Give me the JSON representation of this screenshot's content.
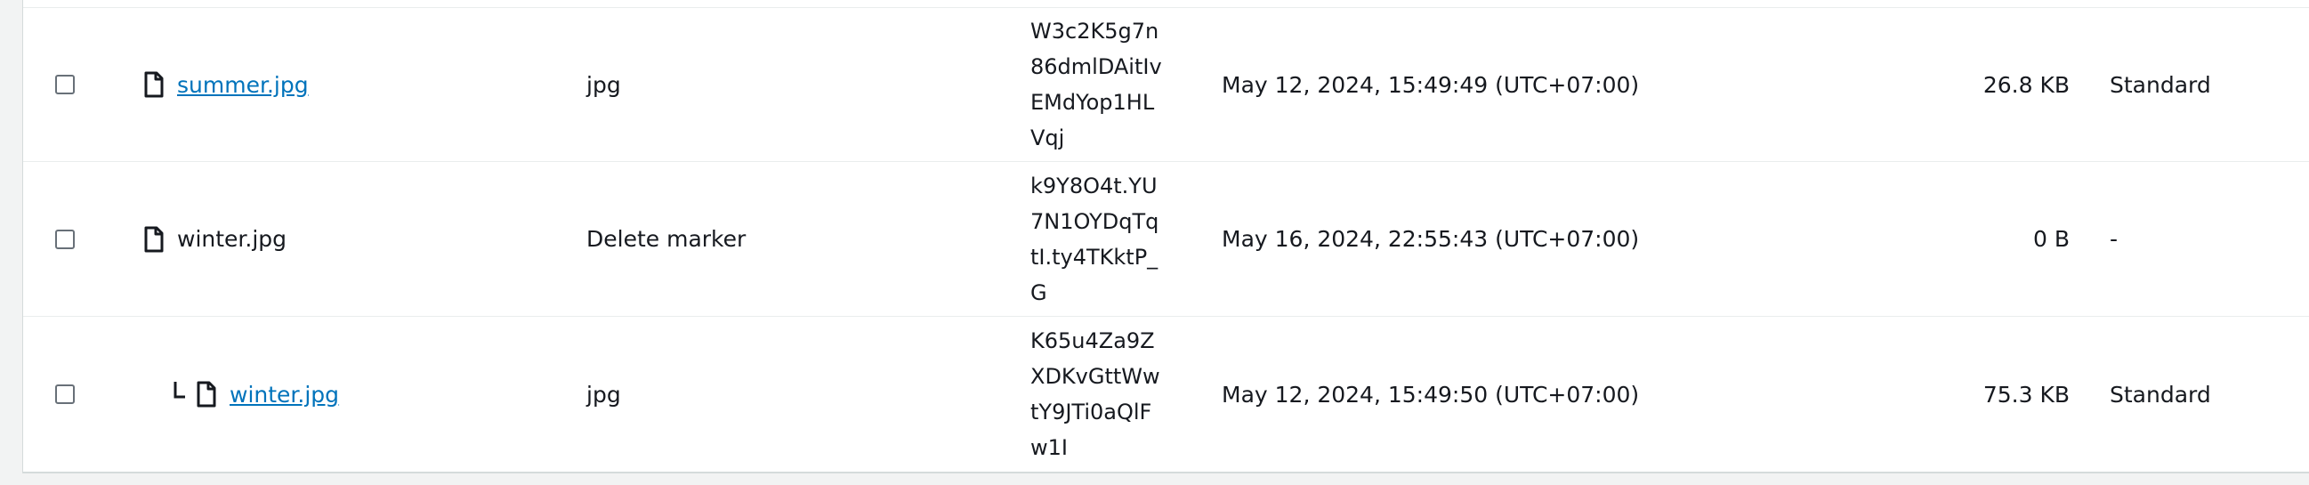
{
  "rows": [
    {
      "name": "summer.jpg",
      "is_link": true,
      "indented": false,
      "type": "jpg",
      "version_lines": [
        "W3c2K5g7n",
        "86dmlDAitIv",
        "EMdYop1HL",
        "Vqj"
      ],
      "last_modified": "May 12, 2024, 15:49:49 (UTC+07:00)",
      "size": "26.8 KB",
      "storage_class": "Standard",
      "icon": "file-icon"
    },
    {
      "name": "winter.jpg",
      "is_link": false,
      "indented": false,
      "type": "Delete marker",
      "version_lines": [
        "k9Y8O4t.YU",
        "7N1OYDqTq",
        "tI.ty4TKktP_",
        "G"
      ],
      "last_modified": "May 16, 2024, 22:55:43 (UTC+07:00)",
      "size": "0 B",
      "storage_class": "-",
      "icon": "file-icon"
    },
    {
      "name": "winter.jpg",
      "is_link": true,
      "indented": true,
      "type": "jpg",
      "version_lines": [
        "K65u4Za9Z",
        "XDKvGttWw",
        "tY9JTi0aQlF",
        "w1I"
      ],
      "last_modified": "May 12, 2024, 15:49:50 (UTC+07:00)",
      "size": "75.3 KB",
      "storage_class": "Standard",
      "icon": "file-icon"
    }
  ],
  "colors": {
    "link": "#0073bb",
    "text": "#16191f",
    "border": "#eaeded",
    "background": "#f2f3f3"
  }
}
